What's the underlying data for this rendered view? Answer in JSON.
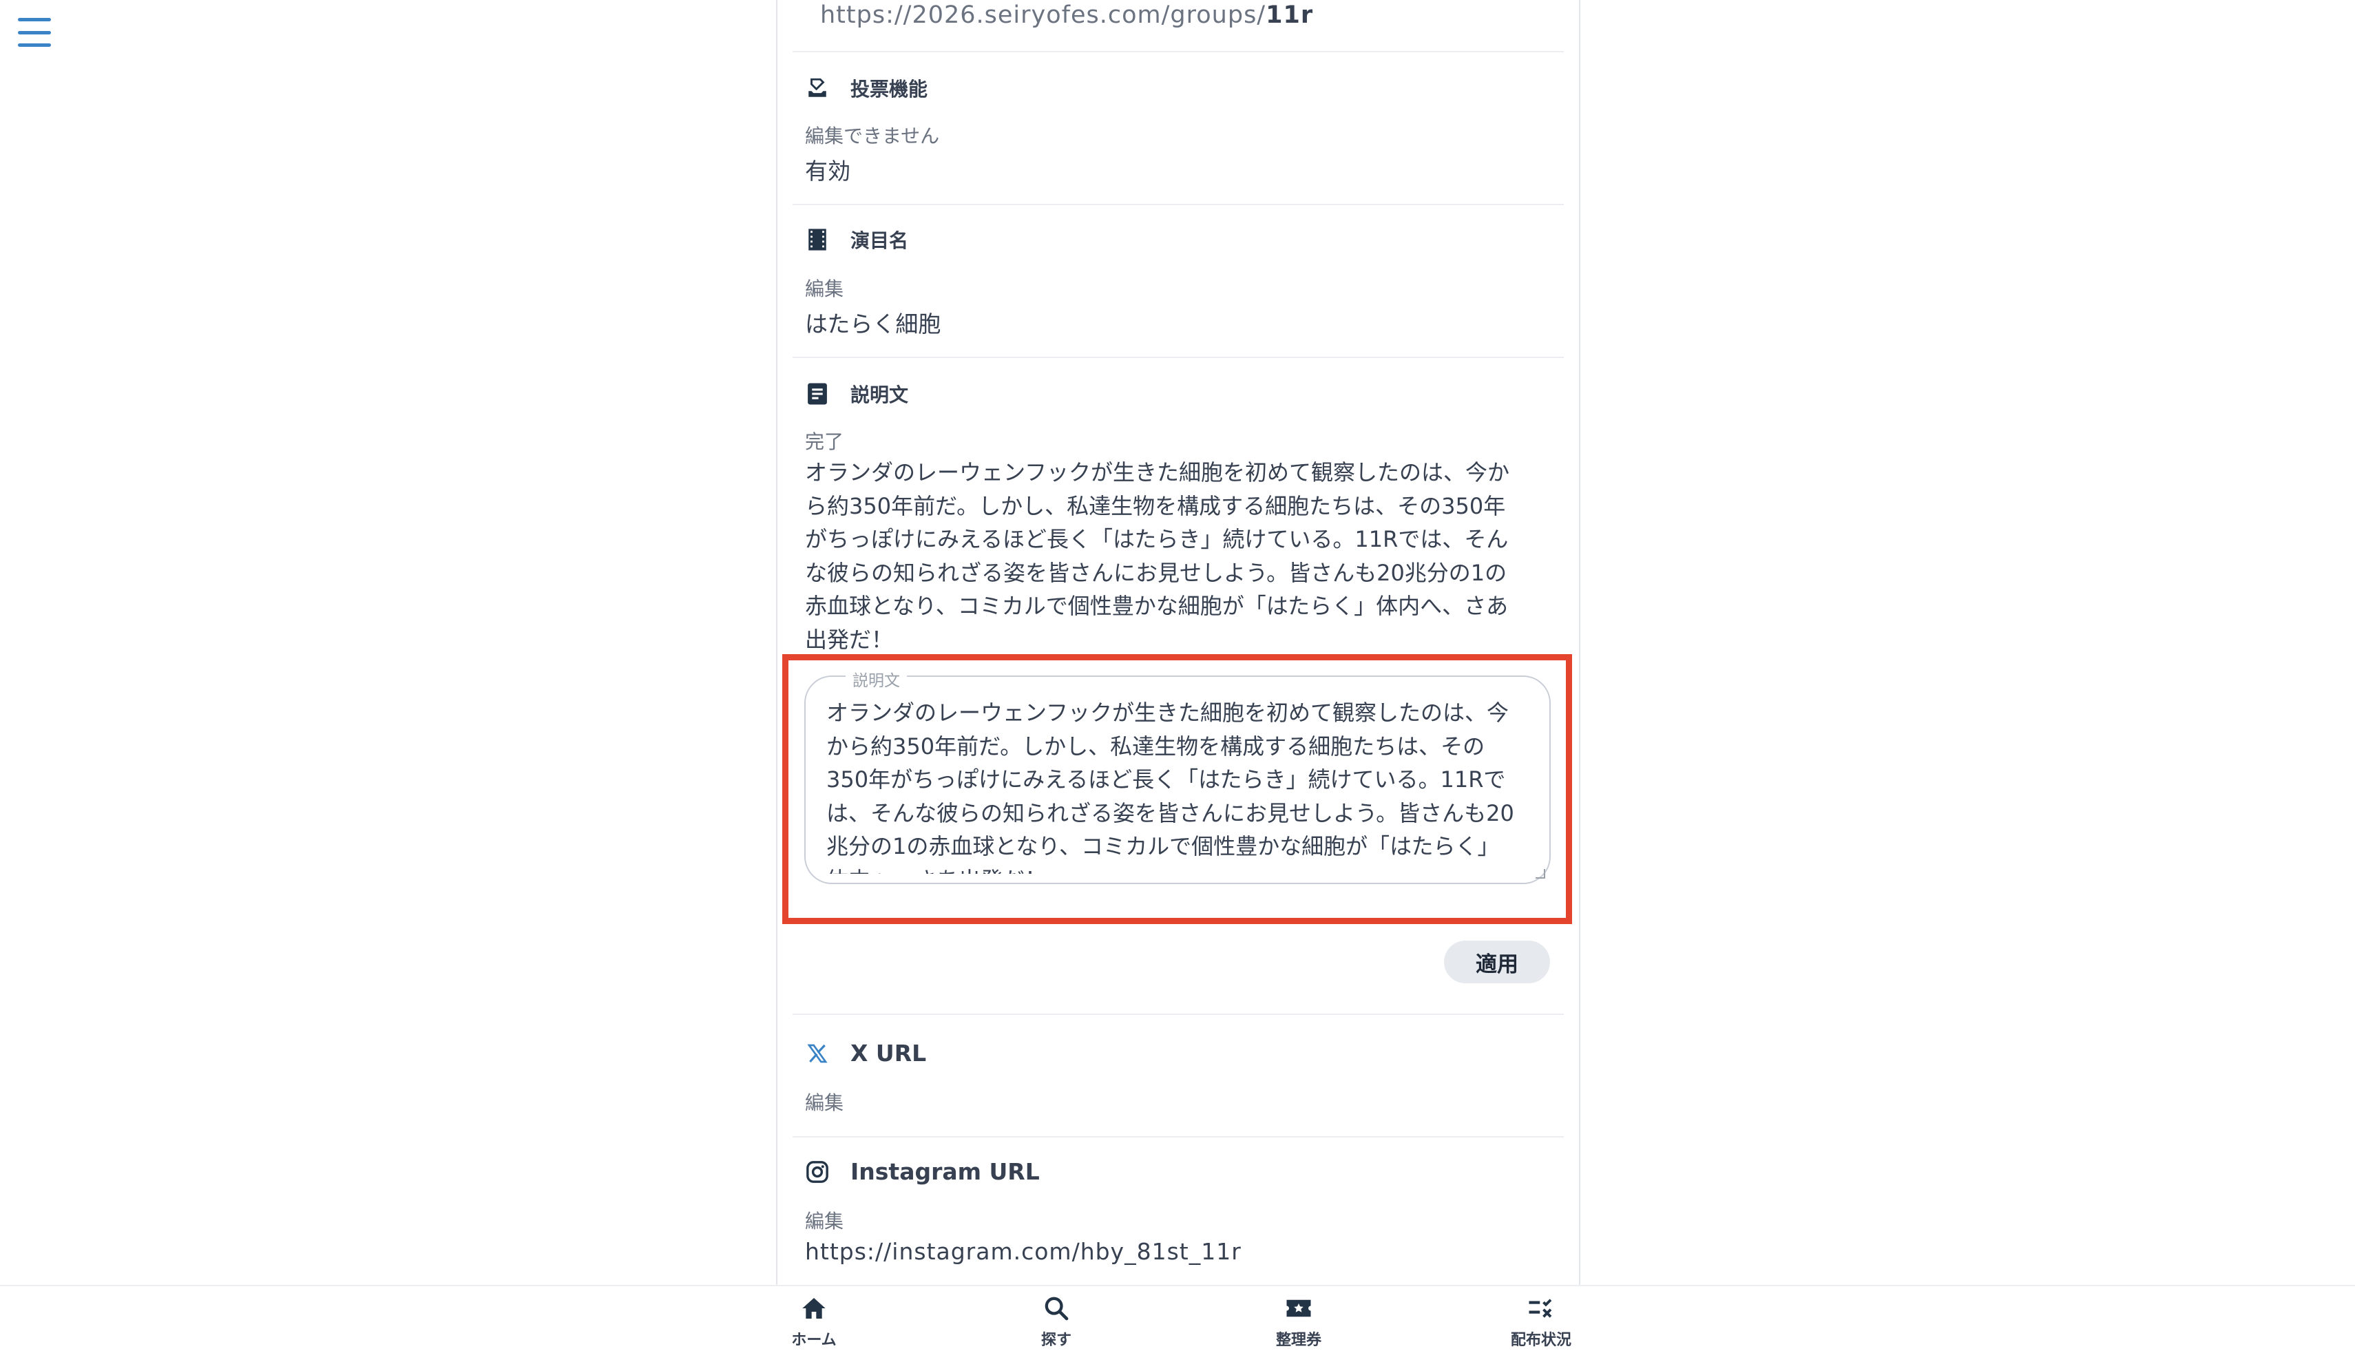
{
  "header": {
    "menu_icon": "hamburger-menu-icon"
  },
  "url_row": {
    "prefix": "https://2026.seiryofes.com/groups/",
    "slug": "11r"
  },
  "voting": {
    "icon": "ballot-box-icon",
    "title": "投票機能",
    "status": "編集できません",
    "value": "有効"
  },
  "performance_name": {
    "icon": "film-strip-icon",
    "title": "演目名",
    "status": "編集",
    "value": "はたらく細胞"
  },
  "description": {
    "icon": "document-icon",
    "title": "説明文",
    "status": "完了",
    "lines": [
      "オランダのレーウェンフックが生きた細胞を初めて観察したのは、今か",
      "ら約350年前だ。しかし、私達生物を構成する細胞たちは、その350年",
      "がちっぽけにみえるほど長く「はたらき」続けている。11Rでは、そん",
      "な彼らの知られざる姿を皆さんにお見せしよう。皆さんも20兆分の1の",
      "赤血球となり、コミカルで個性豊かな細胞が「はたらく」体内へ、さあ",
      "出発だ！"
    ],
    "textarea_label": "説明文",
    "textarea_lines": [
      "オランダのレーウェンフックが生きた細胞を初めて観察したのは、今",
      "から約350年前だ。しかし、私達生物を構成する細胞たちは、その",
      "350年がちっぽけにみえるほど長く「はたらき」続けている。11Rで",
      "は、そんな彼らの知られざる姿を皆さんにお見せしよう。皆さんも20",
      "兆分の1の赤血球となり、コミカルで個性豊かな細胞が「はたらく」",
      "体内へ、さあ出発だ！"
    ],
    "apply_label": "適用"
  },
  "x_url": {
    "icon": "x-logo-icon",
    "title": "X URL",
    "status": "編集"
  },
  "instagram_url": {
    "icon": "instagram-icon",
    "title": "Instagram URL",
    "status": "編集",
    "value": "https://instagram.com/hby_81st_11r"
  },
  "bottom_nav": {
    "items": [
      {
        "label": "ホーム",
        "icon": "home-icon"
      },
      {
        "label": "探す",
        "icon": "search-icon"
      },
      {
        "label": "整理券",
        "icon": "ticket-icon"
      },
      {
        "label": "配布状況",
        "icon": "checklist-icon"
      }
    ]
  },
  "colors": {
    "accent": "#3a83c7",
    "highlight": "#e4432d",
    "text": "#374151",
    "muted": "#6b7280"
  }
}
